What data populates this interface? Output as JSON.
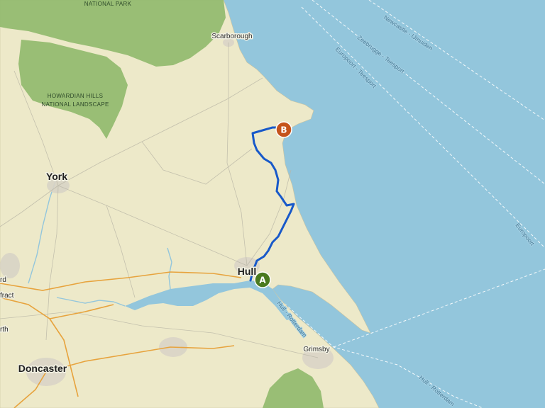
{
  "map": {
    "colors": {
      "sea": "#93c6dc",
      "land": "#ede9c9",
      "national_park": "#8fb96c",
      "route": "#1859c9",
      "marker_a": "#4a7a1e",
      "marker_b": "#c5531b",
      "motorway": "#e7a33d"
    },
    "places": [
      {
        "name": "Scarborough"
      },
      {
        "name": "York"
      },
      {
        "name": "Hull"
      },
      {
        "name": "Doncaster"
      },
      {
        "name": "Grimsby"
      }
    ],
    "edge_labels": {
      "left_top": "rd",
      "left_mid": "fract",
      "left_bot": "rth"
    },
    "areas": {
      "north_york_moors": "NATIONAL PARK",
      "howardian_line1": "HOWARDIAN HILLS",
      "howardian_line2": "NATIONAL LANDSCAPE"
    },
    "ferry_routes": {
      "newcastle_ijmuiden": "Newcastle - IJmuiden",
      "zeebrugge_teesport": "Zeebrugge - Teesport",
      "europoort_teesport": "Europoort - Teesport",
      "hull_rotterdam_1": "Hull - Rotterdam",
      "hull_rotterdam_2": "Hull - Rotterdam",
      "europoort_partial": "Europoort"
    },
    "markers": {
      "start": "A",
      "end": "B"
    }
  }
}
